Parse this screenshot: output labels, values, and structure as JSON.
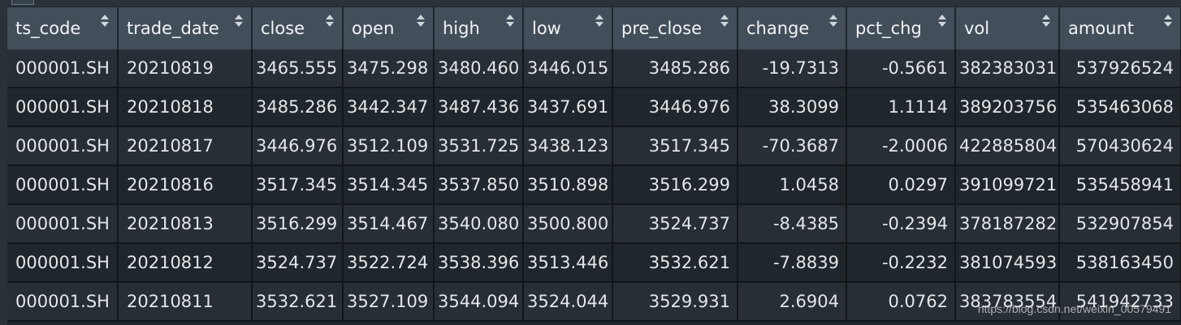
{
  "columns": [
    {
      "label": "ts_code"
    },
    {
      "label": "trade_date"
    },
    {
      "label": "close"
    },
    {
      "label": "open"
    },
    {
      "label": "high"
    },
    {
      "label": "low"
    },
    {
      "label": "pre_close"
    },
    {
      "label": "change"
    },
    {
      "label": "pct_chg"
    },
    {
      "label": "vol"
    },
    {
      "label": "amount"
    }
  ],
  "rows": [
    [
      "000001.SH",
      "20210819",
      "3465.555",
      "3475.298",
      "3480.460",
      "3446.015",
      "3485.286",
      "-19.7313",
      "-0.5661",
      "382383031",
      "537926524"
    ],
    [
      "000001.SH",
      "20210818",
      "3485.286",
      "3442.347",
      "3487.436",
      "3437.691",
      "3446.976",
      "38.3099",
      "1.1114",
      "389203756",
      "535463068"
    ],
    [
      "000001.SH",
      "20210817",
      "3446.976",
      "3512.109",
      "3531.725",
      "3438.123",
      "3517.345",
      "-70.3687",
      "-2.0006",
      "422885804",
      "570430624"
    ],
    [
      "000001.SH",
      "20210816",
      "3517.345",
      "3514.345",
      "3537.850",
      "3510.898",
      "3516.299",
      "1.0458",
      "0.0297",
      "391099721",
      "535458941"
    ],
    [
      "000001.SH",
      "20210813",
      "3516.299",
      "3514.467",
      "3540.080",
      "3500.800",
      "3524.737",
      "-8.4385",
      "-0.2394",
      "378187282",
      "532907854"
    ],
    [
      "000001.SH",
      "20210812",
      "3524.737",
      "3522.724",
      "3538.396",
      "3513.446",
      "3532.621",
      "-7.8839",
      "-0.2232",
      "381074593",
      "538163450"
    ],
    [
      "000001.SH",
      "20210811",
      "3532.621",
      "3527.109",
      "3544.094",
      "3524.044",
      "3529.931",
      "2.6904",
      "0.0762",
      "383783554",
      "541942733"
    ]
  ],
  "watermark": "https://blog.csdn.net/weixin_00579491"
}
